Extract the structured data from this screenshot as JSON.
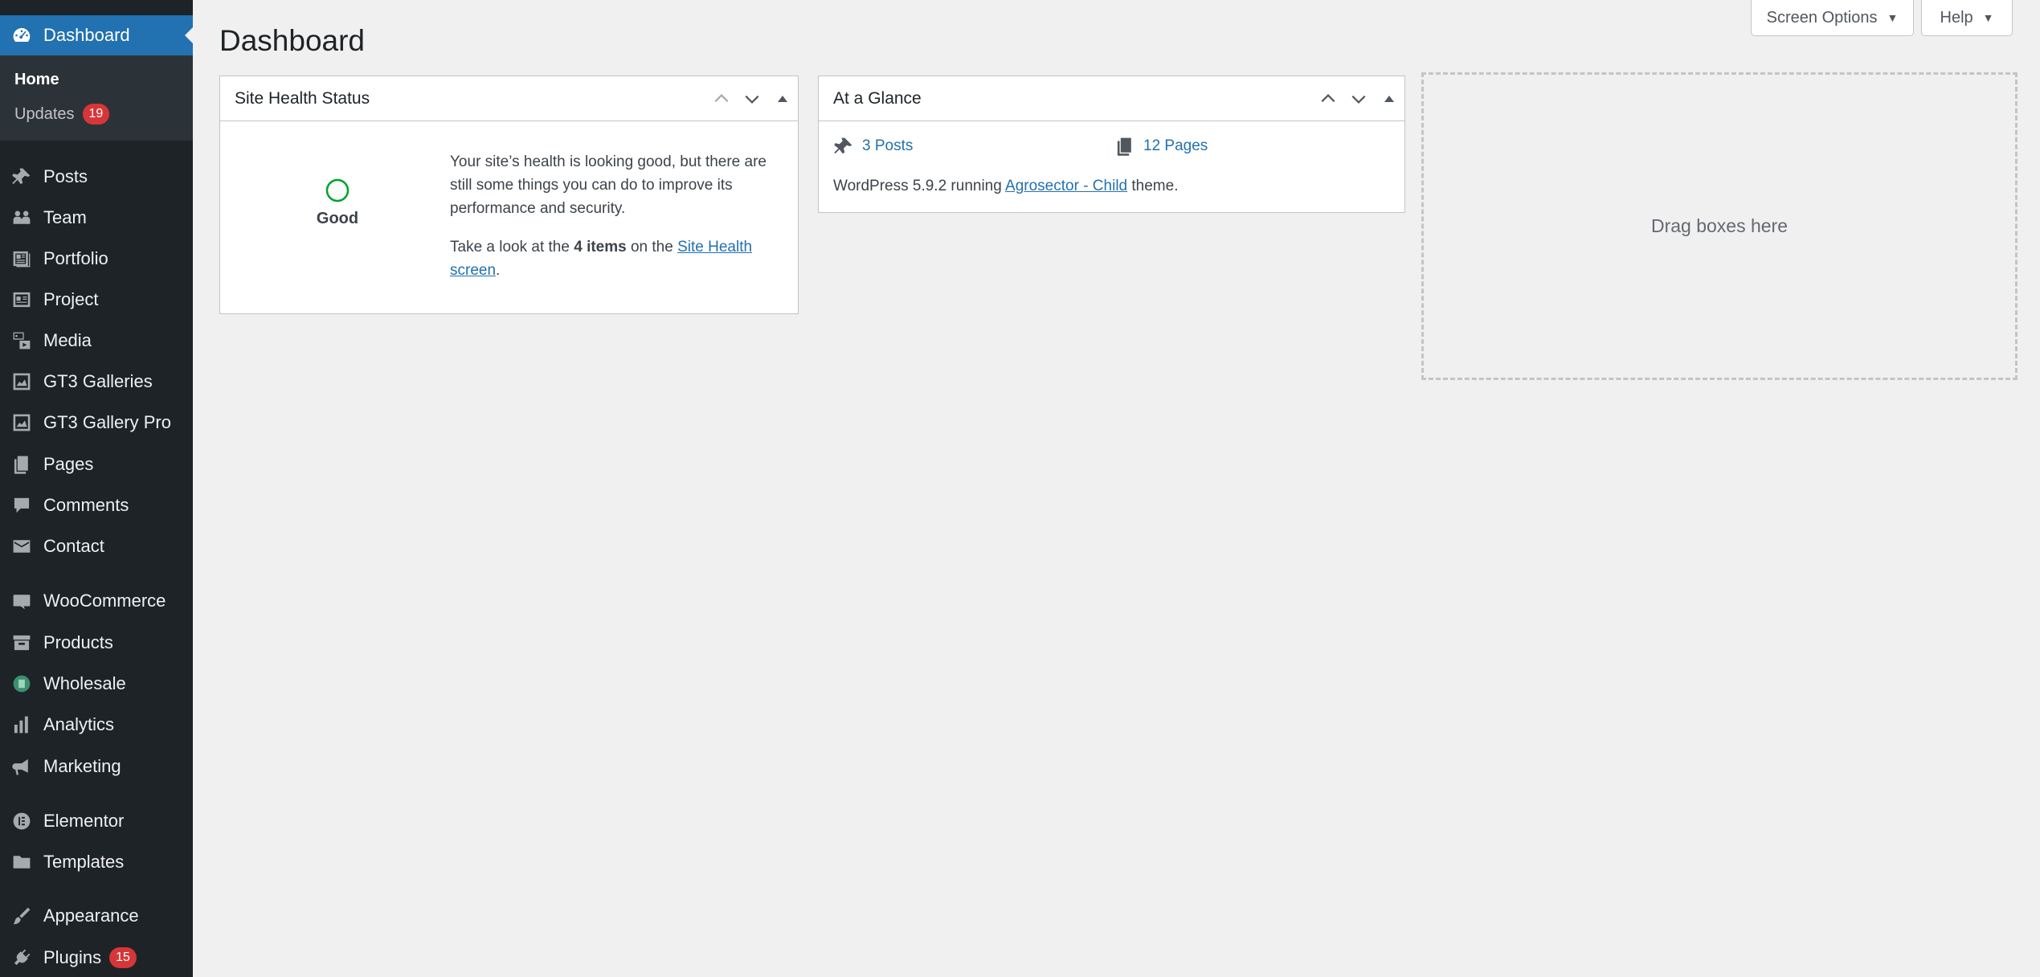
{
  "sidebar": {
    "dashboard": {
      "label": "Dashboard",
      "icon": "dashboard-icon"
    },
    "submenu": [
      {
        "label": "Home"
      },
      {
        "label": "Updates",
        "badge": "19"
      }
    ],
    "items": [
      {
        "label": "Posts",
        "icon": "pin-icon"
      },
      {
        "label": "Team",
        "icon": "team-icon"
      },
      {
        "label": "Portfolio",
        "icon": "portfolio-icon"
      },
      {
        "label": "Project",
        "icon": "project-icon"
      },
      {
        "label": "Media",
        "icon": "media-icon"
      },
      {
        "label": "GT3 Galleries",
        "icon": "gallery-icon"
      },
      {
        "label": "GT3 Gallery Pro",
        "icon": "gallery-pro-icon"
      },
      {
        "label": "Pages",
        "icon": "pages-icon"
      },
      {
        "label": "Comments",
        "icon": "comments-icon"
      },
      {
        "label": "Contact",
        "icon": "mail-icon"
      },
      {
        "label": "WooCommerce",
        "icon": "woocommerce-icon"
      },
      {
        "label": "Products",
        "icon": "products-icon"
      },
      {
        "label": "Wholesale",
        "icon": "wholesale-icon"
      },
      {
        "label": "Analytics",
        "icon": "analytics-icon"
      },
      {
        "label": "Marketing",
        "icon": "megaphone-icon"
      },
      {
        "label": "Elementor",
        "icon": "elementor-icon"
      },
      {
        "label": "Templates",
        "icon": "folder-icon"
      },
      {
        "label": "Appearance",
        "icon": "brush-icon"
      },
      {
        "label": "Plugins",
        "icon": "plug-icon",
        "badge": "15"
      }
    ]
  },
  "header": {
    "title": "Dashboard",
    "screen_options": "Screen Options",
    "help": "Help"
  },
  "site_health": {
    "title": "Site Health Status",
    "status": "Good",
    "message": "Your site’s health is looking good, but there are still some things you can do to improve its performance and security.",
    "take_look_prefix": "Take a look at the ",
    "items_count": "4 items",
    "on_the": " on the ",
    "link_text": "Site Health screen",
    "suffix": "."
  },
  "at_a_glance": {
    "title": "At a Glance",
    "posts": "3 Posts",
    "pages": "12 Pages",
    "running_prefix": "WordPress 5.9.2 running ",
    "theme_link": "Agrosector - Child",
    "running_suffix": " theme."
  },
  "drop_zone": {
    "label": "Drag boxes here"
  },
  "colors": {
    "sidebar_bg": "#1d2327",
    "accent": "#2271b1",
    "badge": "#d63638",
    "health_good": "#00a32a"
  }
}
